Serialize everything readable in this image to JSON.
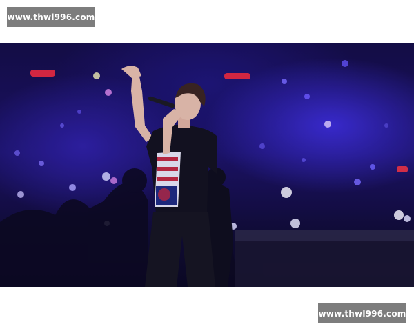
{
  "watermark": {
    "top_text": "www.thwl996.com",
    "bottom_text": "www.thwl996.com"
  },
  "photo": {
    "subject": "singer-performing-on-stage",
    "colors": {
      "stage_purple": "#3a2bd0",
      "stage_dark": "#0e0a2a",
      "red_lights": "#e0283a",
      "shirt": "#111116"
    }
  }
}
